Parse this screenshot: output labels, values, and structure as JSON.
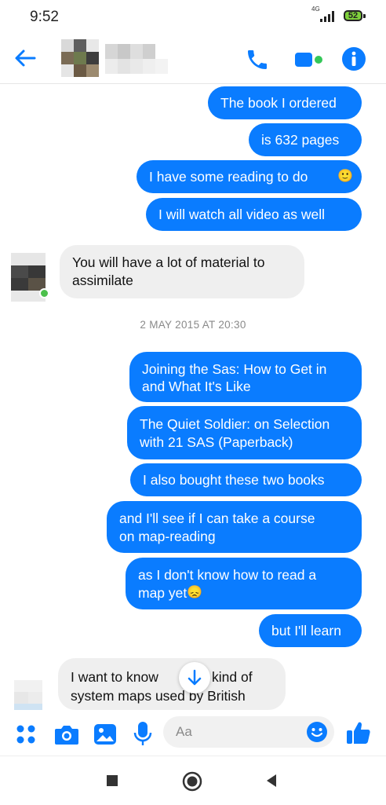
{
  "status_bar": {
    "time": "9:52",
    "network": "4G",
    "battery": "52"
  },
  "header": {
    "contact_name": "",
    "icons": [
      "back-arrow-icon",
      "phone-icon",
      "video-camera-icon",
      "info-icon"
    ]
  },
  "messages": [
    {
      "direction": "outgoing",
      "text": "The book I ordered"
    },
    {
      "direction": "outgoing",
      "text": "is 632 pages"
    },
    {
      "direction": "outgoing",
      "text": "I have some reading to do",
      "emoji": "🙂"
    },
    {
      "direction": "outgoing",
      "text": "I will watch all video as well"
    },
    {
      "direction": "incoming",
      "lines": [
        "You will have a lot of material to",
        "assimilate"
      ]
    },
    {
      "direction": "outgoing",
      "lines": [
        "Joining the Sas: How to Get in",
        "and What It's Like"
      ]
    },
    {
      "direction": "outgoing",
      "lines": [
        "The Quiet Soldier: on Selection",
        "with 21 SAS (Paperback)"
      ]
    },
    {
      "direction": "outgoing",
      "text": "I also bought these two books"
    },
    {
      "direction": "outgoing",
      "lines": [
        "and I'll see if I can take a course",
        "on map-reading"
      ]
    },
    {
      "direction": "outgoing",
      "lines": [
        "as I don't know how to read a",
        "map yet"
      ],
      "emoji": "😞"
    },
    {
      "direction": "outgoing",
      "text": "but I'll learn"
    },
    {
      "direction": "incoming",
      "lines": [
        "I want to know",
        "kind of",
        "system maps used by British"
      ]
    }
  ],
  "timestamp": "2 MAY 2015 AT 20:30",
  "composer": {
    "placeholder": "Aa"
  },
  "colors": {
    "outgoing_bubble": "#0a7cff",
    "incoming_bubble": "#efefef",
    "accent": "#0a7cff",
    "online": "#4cc04c"
  }
}
